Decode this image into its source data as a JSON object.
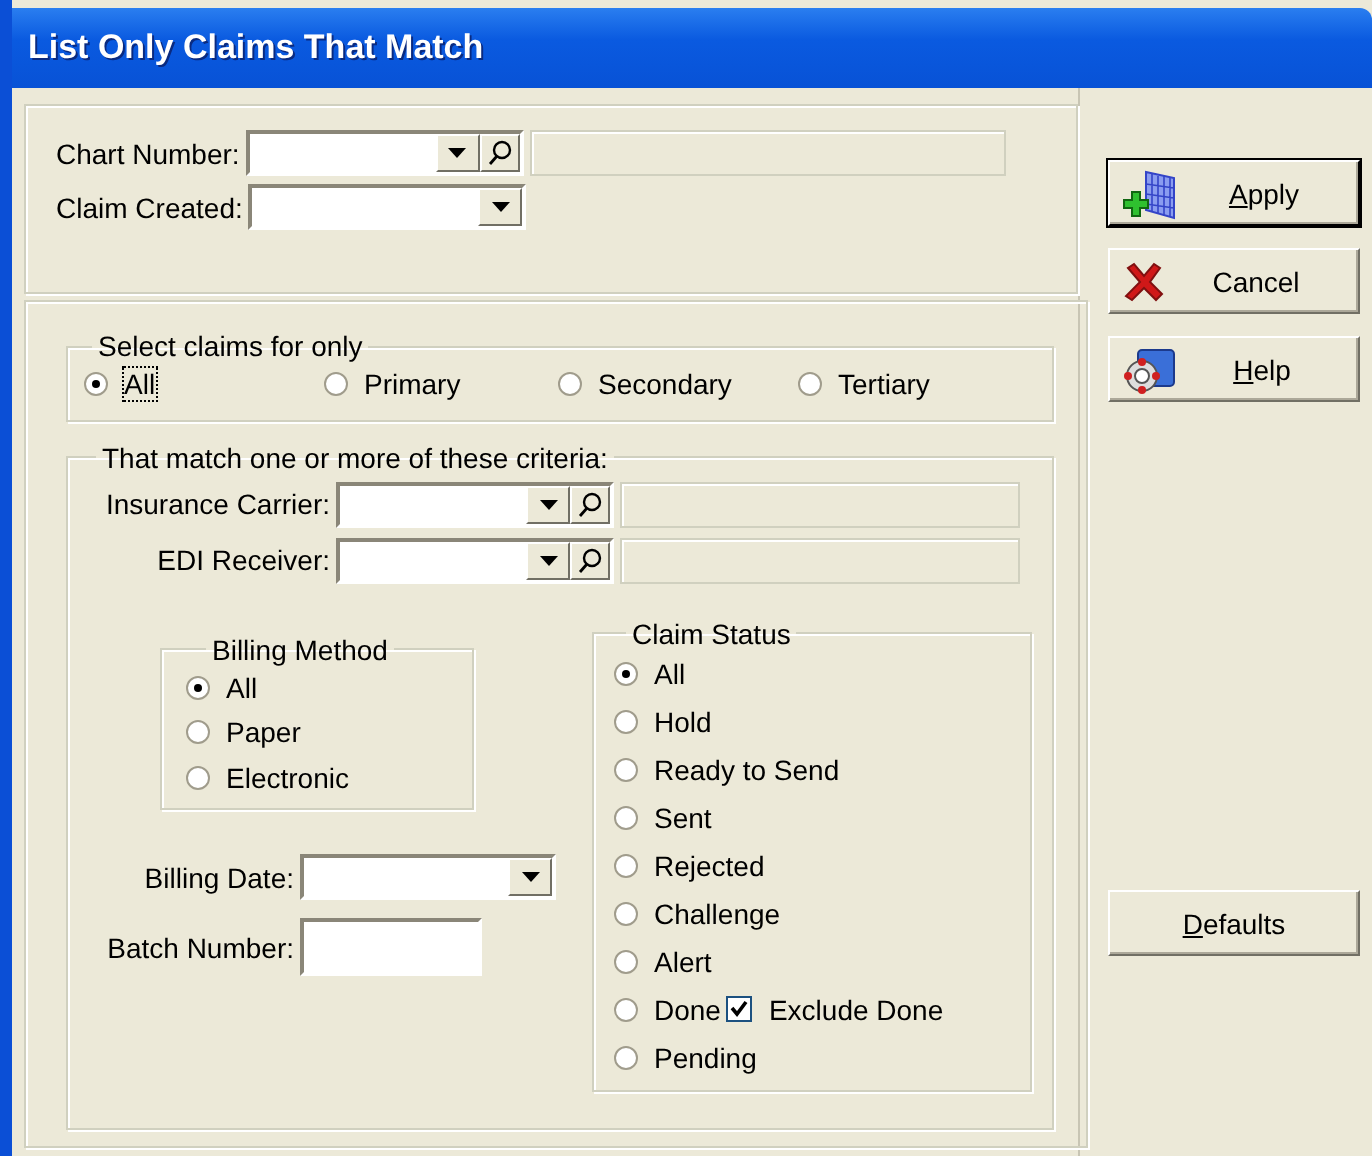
{
  "window": {
    "title": "List Only Claims That Match"
  },
  "header_fields": [
    {
      "label": "Chart Number:",
      "kind": "lookup"
    },
    {
      "label": "Claim Created:",
      "kind": "dropdown"
    }
  ],
  "claim_type": {
    "legend": "Select claims for only",
    "options": [
      {
        "label": "All",
        "selected": true,
        "focused": true
      },
      {
        "label": "Primary",
        "selected": false,
        "focused": false
      },
      {
        "label": "Secondary",
        "selected": false,
        "focused": false
      },
      {
        "label": "Tertiary",
        "selected": false,
        "focused": false
      }
    ]
  },
  "criteria": {
    "legend": "That match one or more of these criteria:",
    "fields": [
      {
        "label": "Insurance Carrier:",
        "kind": "lookup"
      },
      {
        "label": "EDI Receiver:",
        "kind": "lookup"
      }
    ],
    "billing_method": {
      "legend": "Billing Method",
      "options": [
        {
          "label": "All",
          "selected": true
        },
        {
          "label": "Paper",
          "selected": false
        },
        {
          "label": "Electronic",
          "selected": false
        }
      ]
    },
    "date_fields": [
      {
        "label": "Billing Date:",
        "kind": "dropdown"
      },
      {
        "label": "Batch Number:",
        "kind": "text"
      }
    ],
    "claim_status": {
      "legend": "Claim Status",
      "options": [
        {
          "label": "All",
          "selected": true
        },
        {
          "label": "Hold",
          "selected": false
        },
        {
          "label": "Ready to Send",
          "selected": false
        },
        {
          "label": "Sent",
          "selected": false
        },
        {
          "label": "Rejected",
          "selected": false
        },
        {
          "label": "Challenge",
          "selected": false
        },
        {
          "label": "Alert",
          "selected": false
        },
        {
          "label": "Done",
          "selected": false,
          "exclude": {
            "label": "Exclude Done",
            "checked": true
          }
        },
        {
          "label": "Pending",
          "selected": false
        }
      ]
    }
  },
  "buttons": [
    {
      "kind": "apply",
      "accel": "A",
      "rest": "pply",
      "default": true
    },
    {
      "kind": "cancel",
      "rest": "Cancel",
      "default": false
    },
    {
      "kind": "help",
      "accel": "H",
      "rest": "elp",
      "default": false
    },
    {
      "kind": "defaults",
      "accel": "D",
      "rest": "efaults",
      "default": false
    }
  ]
}
